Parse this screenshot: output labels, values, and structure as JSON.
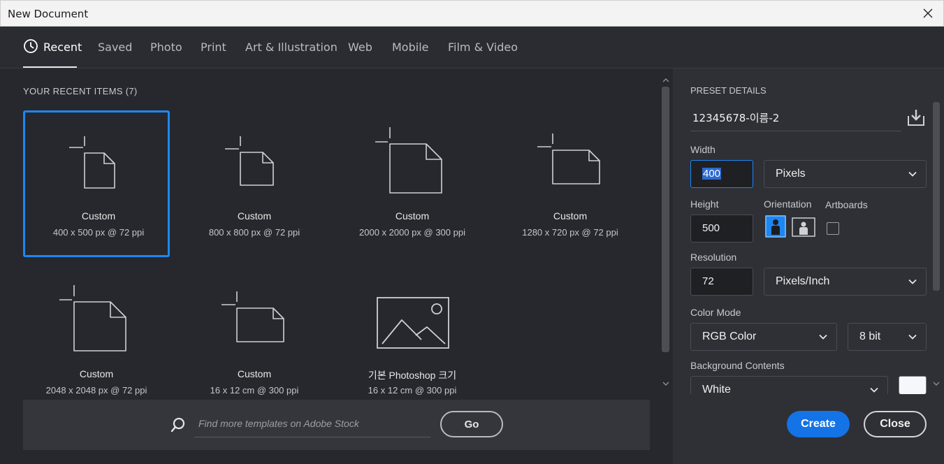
{
  "window": {
    "title": "New Document"
  },
  "tabs": [
    {
      "label": "Recent",
      "active": true
    },
    {
      "label": "Saved"
    },
    {
      "label": "Photo"
    },
    {
      "label": "Print"
    },
    {
      "label": "Art & Illustration"
    },
    {
      "label": "Web"
    },
    {
      "label": "Mobile"
    },
    {
      "label": "Film & Video"
    }
  ],
  "recent": {
    "title": "YOUR RECENT ITEMS  (7)",
    "items": [
      {
        "name": "Custom",
        "size": "400 x 500 px @ 72 ppi",
        "selected": true,
        "icon": "portrait-document-icon"
      },
      {
        "name": "Custom",
        "size": "800 x 800 px @ 72 ppi",
        "icon": "square-document-icon"
      },
      {
        "name": "Custom",
        "size": "2000 x 2000 px @ 300 ppi",
        "icon": "square-document-icon"
      },
      {
        "name": "Custom",
        "size": "1280 x 720 px @ 72 ppi",
        "icon": "landscape-document-icon"
      },
      {
        "name": "Custom",
        "size": "2048 x 2048 px @ 72 ppi",
        "icon": "square-document-icon"
      },
      {
        "name": "Custom",
        "size": "16 x 12 cm @ 300 ppi",
        "icon": "landscape-document-icon"
      },
      {
        "name": "기본 Photoshop 크기",
        "size": "16 x 12 cm @ 300 ppi",
        "icon": "image-placeholder-icon"
      }
    ]
  },
  "search": {
    "placeholder": "Find more templates on Adobe Stock",
    "go_label": "Go"
  },
  "preset": {
    "title": "PRESET DETAILS",
    "name": "12345678-이름-2",
    "width_label": "Width",
    "width_value": "400",
    "width_unit": "Pixels",
    "height_label": "Height",
    "height_value": "500",
    "orientation_label": "Orientation",
    "artboards_label": "Artboards",
    "resolution_label": "Resolution",
    "resolution_value": "72",
    "resolution_unit": "Pixels/Inch",
    "color_mode_label": "Color Mode",
    "color_mode": "RGB Color",
    "bit_depth": "8 bit",
    "background_label": "Background Contents",
    "background": "White",
    "background_color": "#f6f7fa"
  },
  "actions": {
    "create": "Create",
    "close": "Close"
  },
  "colors": {
    "accent": "#1e86f2",
    "create_button": "#1473e6"
  }
}
